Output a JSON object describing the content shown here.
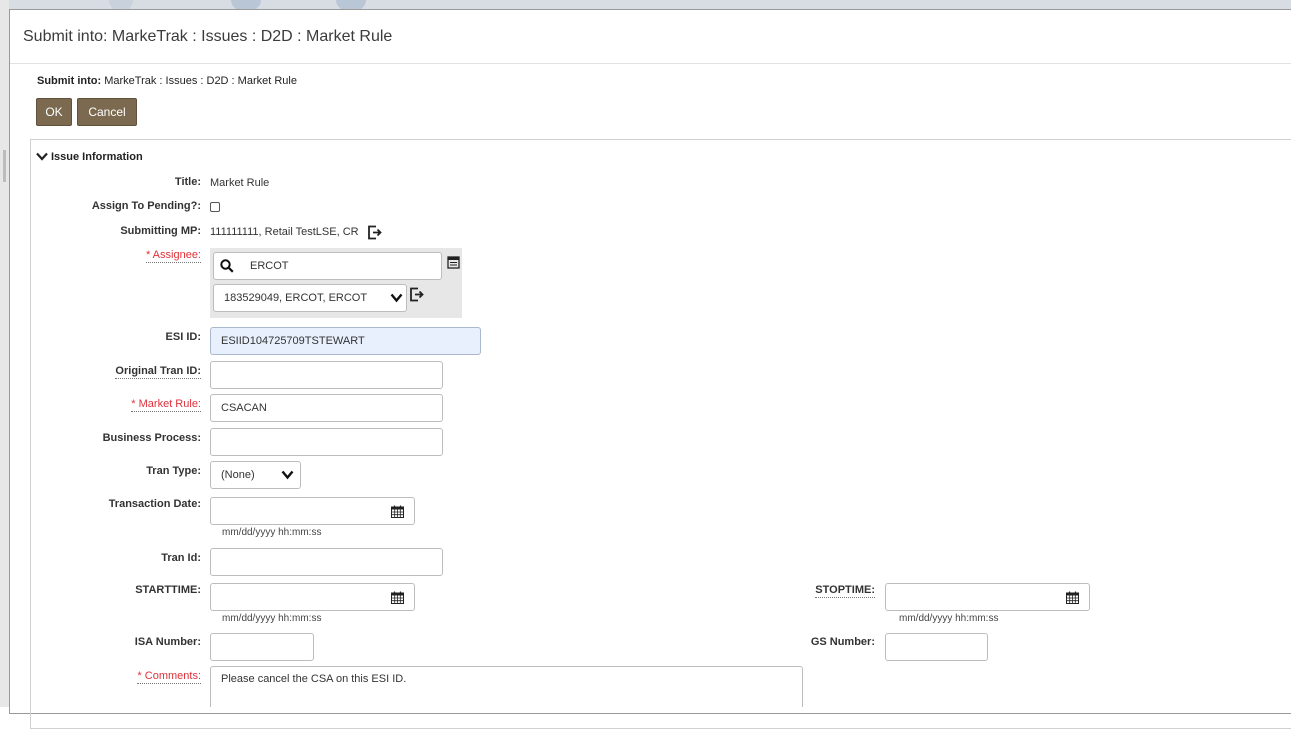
{
  "dialog": {
    "title": "Submit into: MarkeTrak : Issues : D2D : Market Rule",
    "submit_label": "Submit into:",
    "submit_path": "MarkeTrak : Issues : D2D : Market Rule",
    "ok_label": "OK",
    "cancel_label": "Cancel"
  },
  "section": {
    "title": "Issue Information"
  },
  "form": {
    "title_label": "Title:",
    "title_value": "Market Rule",
    "assign_pending_label": "Assign To Pending?:",
    "assign_pending_checked": false,
    "submitting_mp_label": "Submitting MP:",
    "submitting_mp_value": "111111111, Retail TestLSE, CR",
    "assignee_label": "* Assignee:",
    "assignee_search_value": "ERCOT",
    "assignee_selected": "183529049, ERCOT, ERCOT",
    "esi_id_label": "ESI ID:",
    "esi_id_value": "ESIID104725709TSTEWART",
    "original_tran_id_label": "Original Tran ID:",
    "original_tran_id_value": "",
    "market_rule_label": "* Market Rule:",
    "market_rule_value": "CSACAN",
    "business_process_label": "Business Process:",
    "business_process_value": "",
    "tran_type_label": "Tran Type:",
    "tran_type_value": "(None)",
    "transaction_date_label": "Transaction Date:",
    "transaction_date_value": "",
    "date_format_hint": "mm/dd/yyyy hh:mm:ss",
    "tran_id_label": "Tran Id:",
    "tran_id_value": "",
    "starttime_label": "STARTTIME:",
    "starttime_value": "",
    "stoptime_label": "STOPTIME:",
    "stoptime_value": "",
    "isa_number_label": "ISA Number:",
    "isa_number_value": "",
    "gs_number_label": "GS Number:",
    "gs_number_value": "",
    "comments_label": "* Comments:",
    "comments_value": "Please cancel the CSA on this ESI ID."
  },
  "colors": {
    "button_bg": "#7b6a4f",
    "required_label": "#e0313a",
    "highlight_field": "#e8f0fe",
    "assignee_panel": "#e7e7e7"
  },
  "icons": [
    "search-icon",
    "calendar-icon",
    "external-link-icon",
    "chevron-down-icon",
    "list-icon"
  ]
}
